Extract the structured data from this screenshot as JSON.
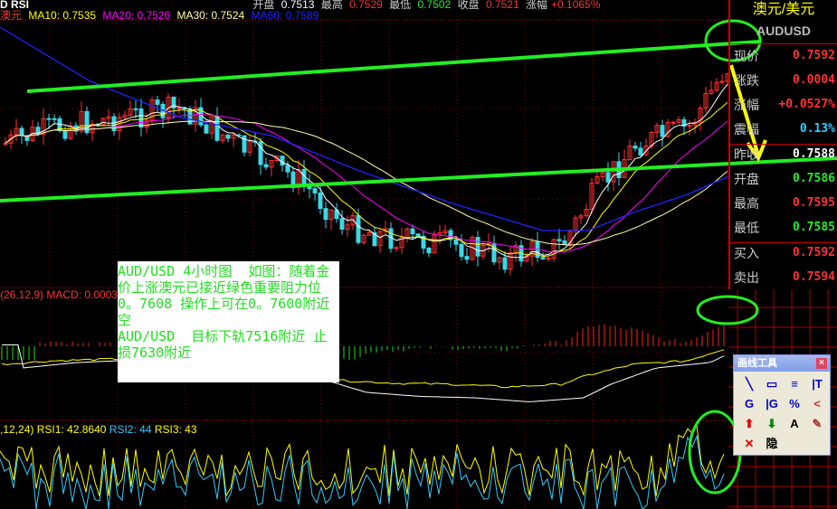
{
  "header": {
    "indicator": "D RSI",
    "open_label": "开盘",
    "open": "0.7513",
    "high_label": "最高",
    "high": "0.7529",
    "low_label": "最低",
    "low": "0.7502",
    "close_label": "收盘",
    "close": "0.7521",
    "change_label": "涨幅",
    "change": "+0.1065%"
  },
  "ma": {
    "symbol": "澳元",
    "ma10": "MA10: 0.7535",
    "ma20": "MA20: 0.7526",
    "ma30": "MA30: 0.7524",
    "ma60": "MA60: 0.7589"
  },
  "side": {
    "title": "澳元/美元",
    "code": "AUDUSD",
    "rows": [
      {
        "label": "现价",
        "value": "0.7592",
        "color": "#ff3333"
      },
      {
        "label": "涨跌",
        "value": "0.0004",
        "color": "#ff3333"
      },
      {
        "label": "涨幅",
        "value": "+0.0527%",
        "color": "#ff3333"
      },
      {
        "label": "震幅",
        "value": "0.13%",
        "color": "#33ccff"
      },
      {
        "label": "昨收",
        "value": "0.7588",
        "color": "#ffffff"
      },
      {
        "label": "开盘",
        "value": "0.7586",
        "color": "#22ee22"
      },
      {
        "label": "最高",
        "value": "0.7595",
        "color": "#ff3333"
      },
      {
        "label": "最低",
        "value": "0.7585",
        "color": "#22ee22"
      },
      {
        "label": "买入",
        "value": "0.7592",
        "color": "#ff3333"
      },
      {
        "label": "卖出",
        "value": "0.7594",
        "color": "#ff3333"
      }
    ]
  },
  "note": "AUD/USD 4小时图  如图：随着金价上涨澳元已接近绿色重要阻力位0。7608 操作上可在0。7600附近空\nAUD/USD  目标下轨7516附近 止损7630附近",
  "macd": {
    "label": "(26,12,9) MACD: 0.0003"
  },
  "rsi": {
    "params": ",12,24)",
    "rsi1": "RSI1: 42.8640",
    "rsi2": "RSI2: 44",
    "rsi3": "RSI3: 43"
  },
  "toolbar": {
    "title": "画线工具",
    "close": "×",
    "tools": [
      {
        "icon": "line-icon",
        "glyph": "╲"
      },
      {
        "icon": "rectangle-icon",
        "glyph": "▭"
      },
      {
        "icon": "parallel-lines-icon",
        "glyph": "≡"
      },
      {
        "icon": "text-lines-icon",
        "glyph": "|T"
      },
      {
        "icon": "gann-h-icon",
        "glyph": "G"
      },
      {
        "icon": "gann-v-icon",
        "glyph": "|G"
      },
      {
        "icon": "percent-lines-icon",
        "glyph": "%"
      },
      {
        "icon": "fan-icon",
        "glyph": "<"
      },
      {
        "icon": "up-arrow-icon",
        "glyph": "⬆"
      },
      {
        "icon": "down-arrow-icon",
        "glyph": "⬇"
      },
      {
        "icon": "text-icon",
        "glyph": "A"
      },
      {
        "icon": "eraser-icon",
        "glyph": "✎"
      },
      {
        "icon": "delete-icon",
        "glyph": "✕"
      },
      {
        "icon": "hide-icon",
        "glyph": "隐"
      }
    ]
  }
}
